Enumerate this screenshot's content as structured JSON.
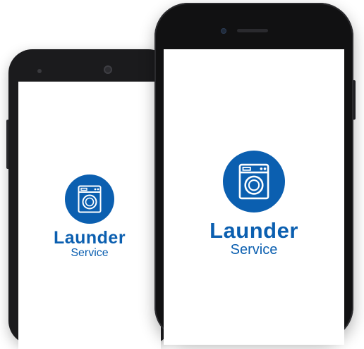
{
  "app": {
    "name": "Launder",
    "tagline": "Service",
    "brand_color": "#0b5fb0"
  },
  "devices": [
    {
      "type": "android-phone",
      "logo_icon": "washing-machine-icon"
    },
    {
      "type": "iphone",
      "logo_icon": "washing-machine-icon"
    }
  ]
}
